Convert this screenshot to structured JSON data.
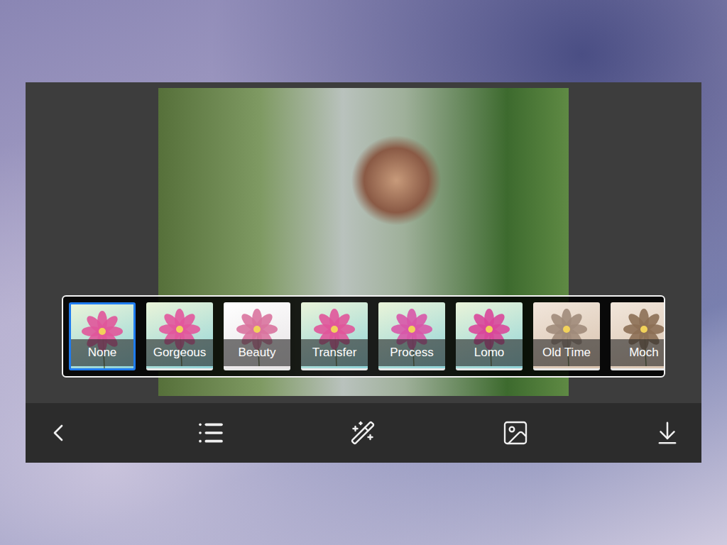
{
  "filters": [
    {
      "label": "None",
      "selected": true,
      "kind": "color",
      "color": "#e0559a"
    },
    {
      "label": "Gorgeous",
      "selected": false,
      "kind": "color",
      "color": "#e2579c"
    },
    {
      "label": "Beauty",
      "selected": false,
      "kind": "soft",
      "color": "#d9739f"
    },
    {
      "label": "Transfer",
      "selected": false,
      "kind": "color",
      "color": "#e0559a"
    },
    {
      "label": "Process",
      "selected": false,
      "kind": "color",
      "color": "#d857a8"
    },
    {
      "label": "Lomo",
      "selected": false,
      "kind": "color",
      "color": "#d9479a"
    },
    {
      "label": "Old Time",
      "selected": false,
      "kind": "sepia",
      "color": "#a08b7a"
    },
    {
      "label": "Moch",
      "selected": false,
      "kind": "sepia",
      "color": "#8c6f55"
    }
  ]
}
